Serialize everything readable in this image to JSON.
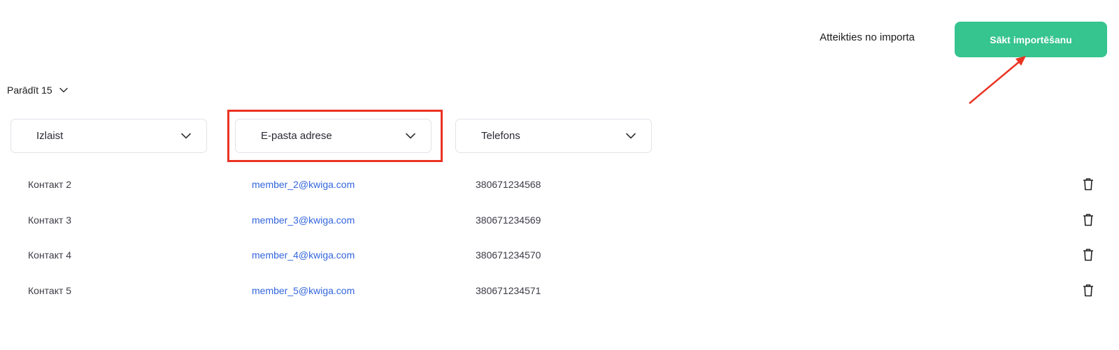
{
  "header": {
    "cancel_label": "Atteikties no importa",
    "start_label": "Sākt importēšanu"
  },
  "pagination": {
    "show_label": "Parādīt",
    "page_size": "15"
  },
  "columns": [
    {
      "label": "Izlaist"
    },
    {
      "label": "E-pasta adrese"
    },
    {
      "label": "Telefons"
    }
  ],
  "rows": [
    {
      "name": "Контакт 2",
      "email": "member_2@kwiga.com",
      "phone": "380671234568"
    },
    {
      "name": "Контакт 3",
      "email": "member_3@kwiga.com",
      "phone": "380671234569"
    },
    {
      "name": "Контакт 4",
      "email": "member_4@kwiga.com",
      "phone": "380671234570"
    },
    {
      "name": "Контакт 5",
      "email": "member_5@kwiga.com",
      "phone": "380671234571"
    }
  ],
  "colors": {
    "primary_green": "#36c48f",
    "link_blue": "#3366dd",
    "annotation_red": "#ea3323"
  },
  "icons": {
    "dropdown": "chevron-down-icon",
    "row_action": "trash-icon"
  }
}
